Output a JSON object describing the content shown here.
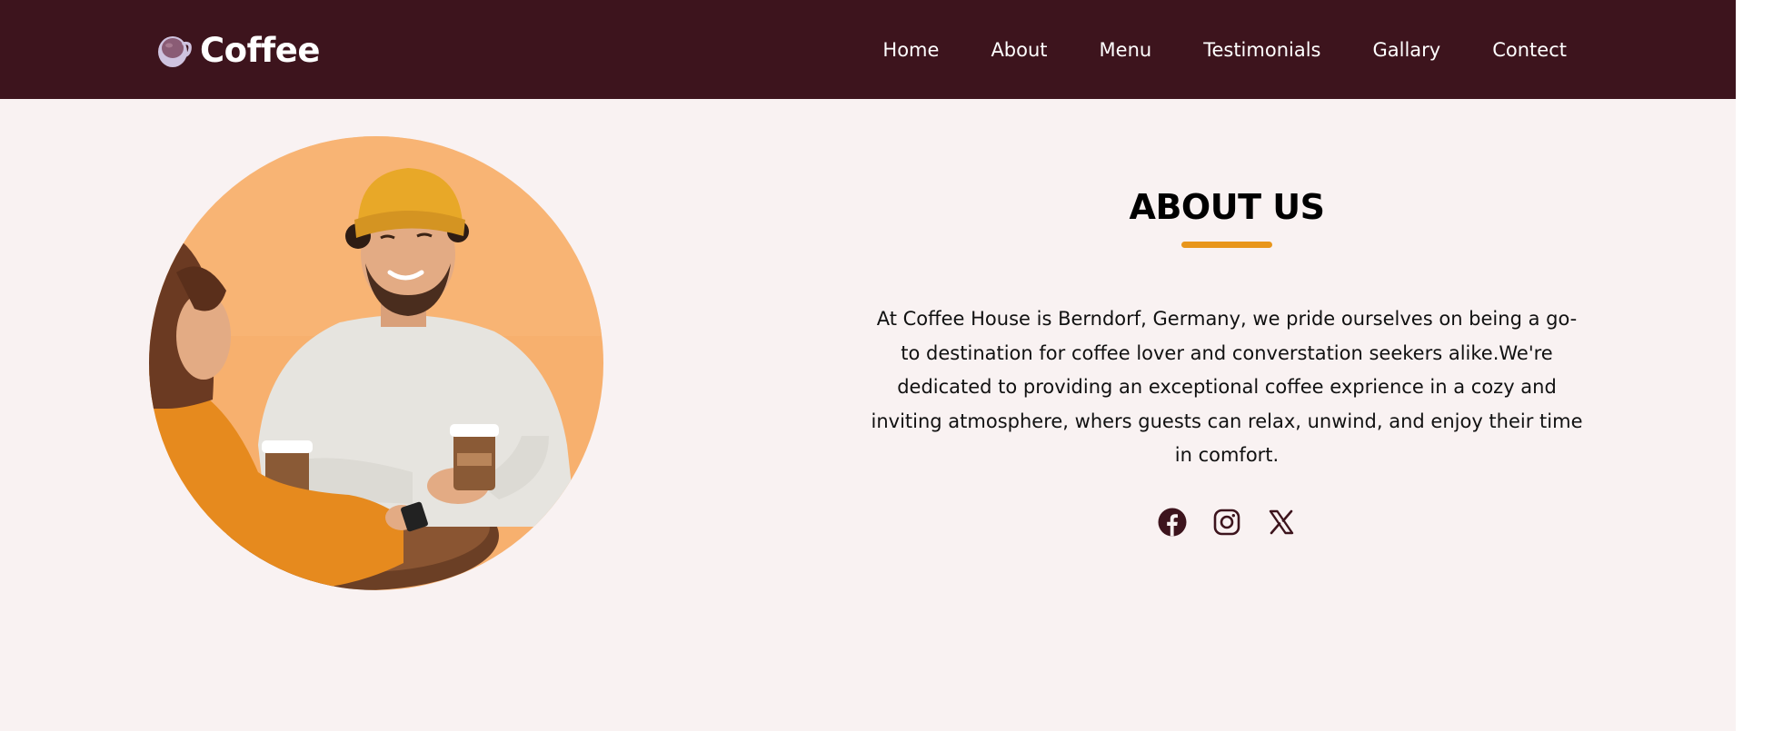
{
  "brand": {
    "name": "Coffee"
  },
  "nav": {
    "items": [
      {
        "label": "Home"
      },
      {
        "label": "About"
      },
      {
        "label": "Menu"
      },
      {
        "label": "Testimonials"
      },
      {
        "label": "Gallary"
      },
      {
        "label": "Contect"
      }
    ]
  },
  "about": {
    "title": "ABOUT US",
    "body": "At Coffee House is Berndorf, Germany, we pride ourselves on being a go-to destination for coffee lover and converstation seekers alike.We're dedicated to providing an exceptional coffee exprience in a cozy and inviting atmosphere, whers guests can relax, unwind, and enjoy their time in comfort.",
    "socials": [
      {
        "icon": "facebook-icon"
      },
      {
        "icon": "instagram-icon"
      },
      {
        "icon": "x-twitter-icon"
      }
    ]
  },
  "colors": {
    "navbar": "#3d141d",
    "page_background": "#f9f2f2",
    "accent": "#e8961c",
    "icon": "#3d141d"
  }
}
